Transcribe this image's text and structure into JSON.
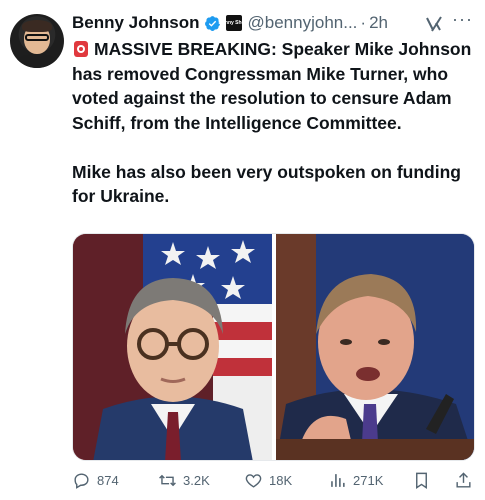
{
  "author": {
    "name": "Benny Johnson",
    "handle": "@bennyjohn...",
    "separator": "·",
    "time": "2h",
    "affiliate_badge_text": "Benny Show"
  },
  "tweet": {
    "paragraph1": "MASSIVE BREAKING: Speaker Mike Johnson has removed Congressman Mike Turner, who voted against the resolution to censure Adam Schiff, from the Intelligence Committee.",
    "paragraph2": "Mike has also been very outspoken on funding for Ukraine."
  },
  "media": {
    "photos": [
      "photo-speaker-mike-johnson",
      "photo-congressman-mike-turner"
    ]
  },
  "actions": {
    "replies": "874",
    "retweets": "3.2K",
    "likes": "18K",
    "views": "271K"
  },
  "icons": {
    "verified": "verified-badge-icon",
    "grok": "grok-icon",
    "more": "more-icon",
    "siren": "siren-emoji-icon",
    "reply": "reply-icon",
    "retweet": "retweet-icon",
    "like": "heart-icon",
    "views": "views-chart-icon",
    "bookmark": "bookmark-icon",
    "share": "share-icon"
  },
  "colors": {
    "text": "#0f1419",
    "secondary": "#536471",
    "verified": "#1d9bf0"
  }
}
